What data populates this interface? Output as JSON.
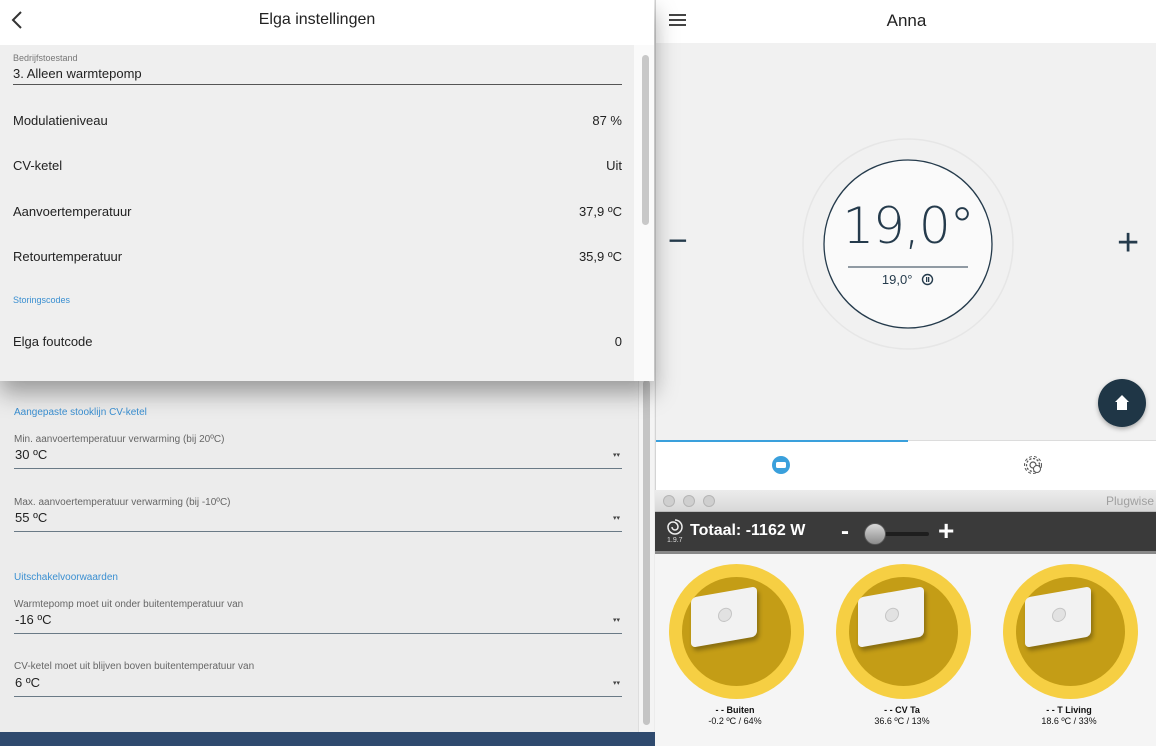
{
  "elga": {
    "title": "Elga instellingen",
    "mode_label": "Bedrijfstoestand",
    "mode_value": "3. Alleen warmtepomp",
    "rows": [
      {
        "label": "Modulatieniveau",
        "value": "87 %"
      },
      {
        "label": "CV-ketel",
        "value": "Uit"
      },
      {
        "label": "Aanvoertemperatuur",
        "value": "37,9 ºC"
      },
      {
        "label": "Retourtemperatuur",
        "value": "35,9 ºC"
      }
    ],
    "fault_section": "Storingscodes",
    "fault_row": {
      "label": "Elga foutcode",
      "value": "0"
    }
  },
  "settings": {
    "section_curve": "Aangepaste stooklijn CV-ketel",
    "fields": [
      {
        "label": "Min. aanvoertemperatuur verwarming (bij 20ºC)",
        "value": "30 ºC"
      },
      {
        "label": "Max. aanvoertemperatuur verwarming (bij -10ºC)",
        "value": "55 ºC"
      }
    ],
    "section_off": "Uitschakelvoorwaarden",
    "fields_off": [
      {
        "label": "Warmtepomp moet uit onder buitentemperatuur van",
        "value": "-16 ºC"
      },
      {
        "label": "CV-ketel moet uit blijven boven buitentemperatuur van",
        "value": "6 ºC"
      }
    ],
    "dropdown_glyph": "▾▾"
  },
  "anna": {
    "title": "Anna",
    "minus": "−",
    "plus": "+",
    "temperature": "19,0°",
    "setpoint": "19,0°",
    "colors": {
      "dark": "#1f3646",
      "accent": "#3aa0dc"
    }
  },
  "plugwise": {
    "window_title": "Plugwise",
    "version": "1.9.7",
    "total": "Totaal: -1162 W",
    "minus": "-",
    "plus": "+",
    "devices": [
      {
        "name": "- - Buiten",
        "value": "-0.2 ºC / 64%"
      },
      {
        "name": "- - CV Ta",
        "value": "36.6 ºC / 13%"
      },
      {
        "name": "- - T Living",
        "value": "18.6 ºC / 33%"
      }
    ],
    "colors": {
      "ring": "#f6cf43",
      "inner": "#c49d16"
    }
  }
}
